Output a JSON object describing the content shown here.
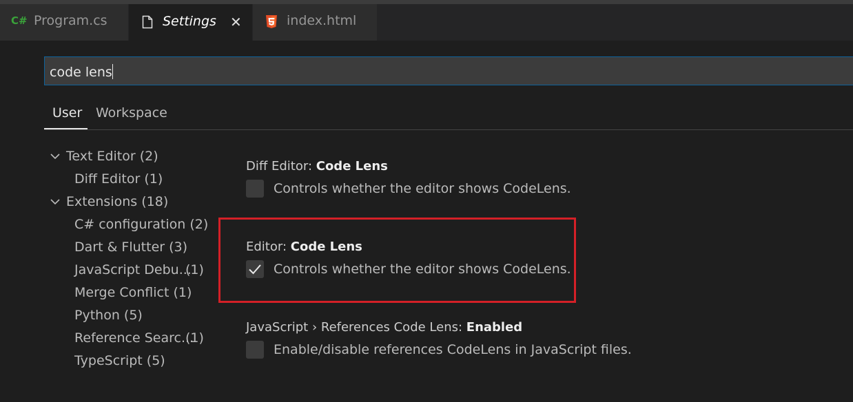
{
  "tabs": {
    "program_cs": {
      "icon_text": "C#",
      "label": "Program.cs"
    },
    "settings": {
      "label": "Settings",
      "close_glyph": "✕"
    },
    "index_html": {
      "label": "index.html"
    }
  },
  "search": {
    "value": "code lens"
  },
  "scope_tabs": {
    "user": "User",
    "workspace": "Workspace"
  },
  "toc": {
    "text_editor": {
      "label": "Text Editor",
      "count": "(2)"
    },
    "diff_editor": {
      "label": "Diff Editor",
      "count": "(1)"
    },
    "extensions": {
      "label": "Extensions",
      "count": "(18)"
    },
    "csharp": {
      "label": "C# configuration",
      "count": "(2)"
    },
    "dart": {
      "label": "Dart & Flutter",
      "count": "(3)"
    },
    "javascript_debug": {
      "label": "JavaScript Debu...",
      "count": "(1)"
    },
    "merge_conflict": {
      "label": "Merge Conflict",
      "count": "(1)"
    },
    "python": {
      "label": "Python",
      "count": "(5)"
    },
    "reference_search": {
      "label": "Reference Searc...",
      "count": "(1)"
    },
    "typescript": {
      "label": "TypeScript",
      "count": "(5)"
    }
  },
  "settings": [
    {
      "category": "Diff Editor: ",
      "name": "Code Lens",
      "description": "Controls whether the editor shows CodeLens.",
      "checked": false
    },
    {
      "category": "Editor: ",
      "name": "Code Lens",
      "description": "Controls whether the editor shows CodeLens.",
      "checked": true
    },
    {
      "category": "JavaScript › References Code Lens: ",
      "name": "Enabled",
      "description": "Enable/disable references CodeLens in JavaScript files.",
      "checked": false
    }
  ],
  "colors": {
    "highlight": "#d42027",
    "csharp_icon": "#3aa23a",
    "html5_icon": "#e44d26"
  }
}
